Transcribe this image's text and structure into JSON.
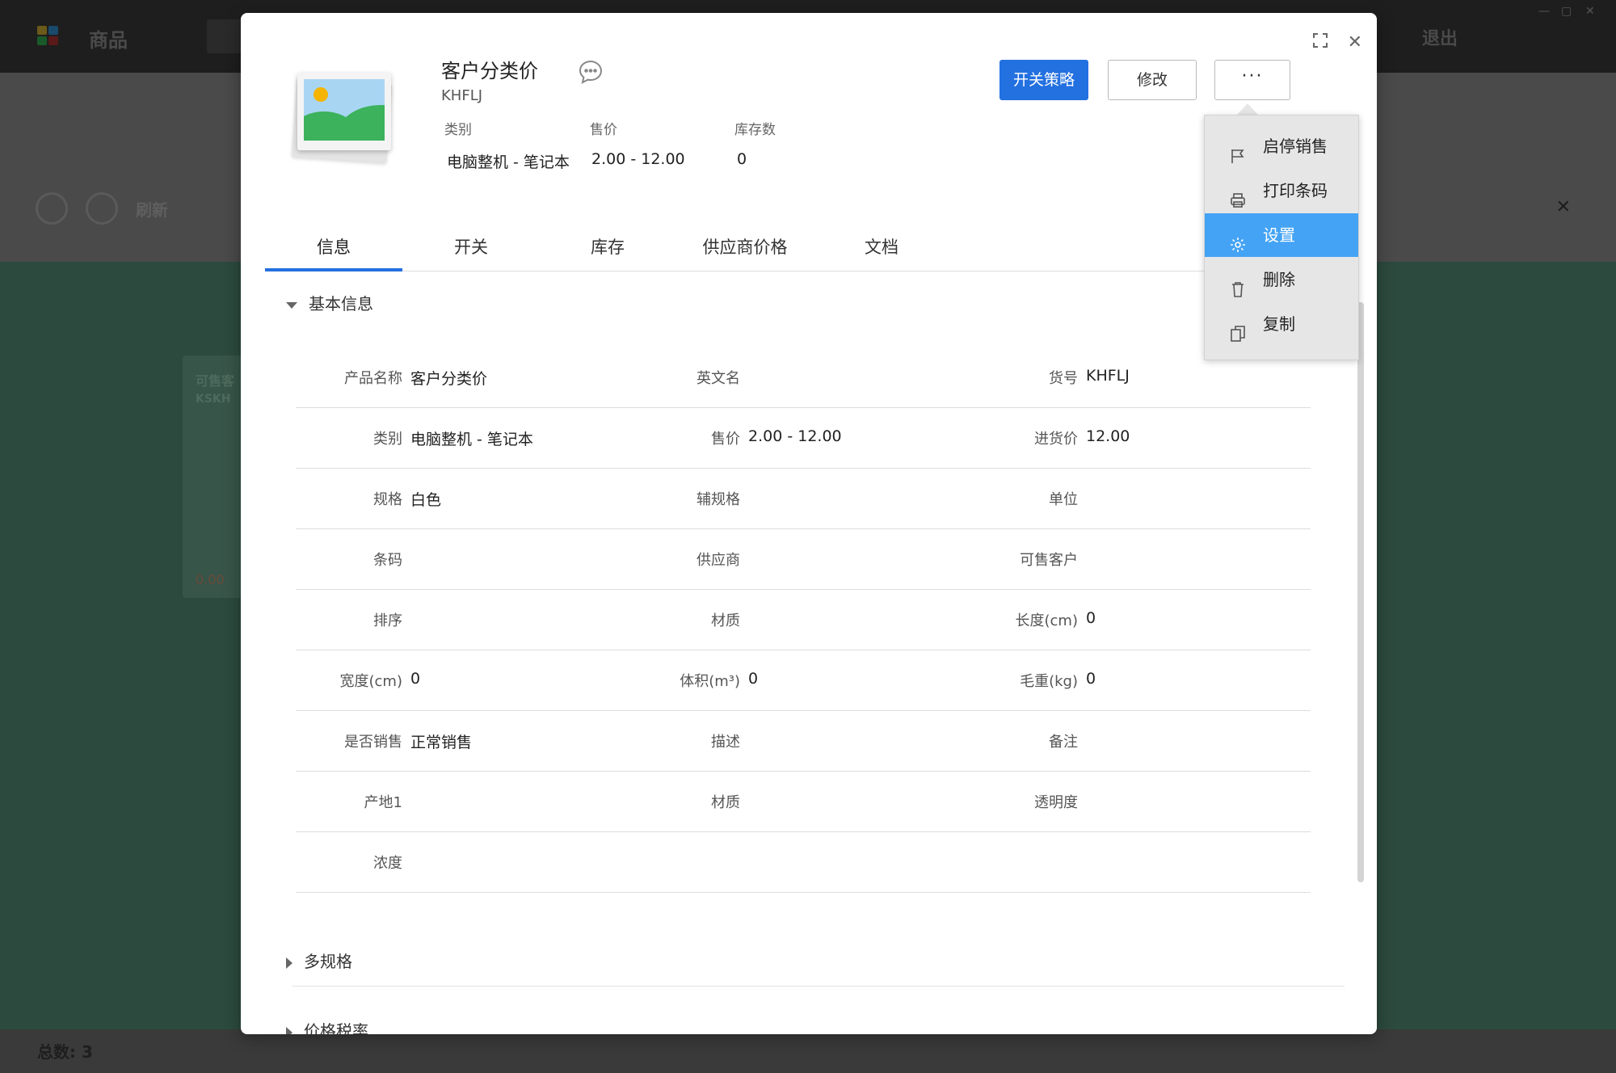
{
  "background": {
    "app_title": "商品",
    "exit_label": "退出",
    "refresh_label": "刷新",
    "card_title": "可售客",
    "card_code": "KSKH",
    "card_price": "0.00",
    "total_label": "总数: 3"
  },
  "dialog": {
    "product_name": "客户分类价",
    "product_code": "KHFLJ",
    "summary": {
      "category_label": "类别",
      "category_value": "电脑整机 - 笔记本",
      "price_label": "售价",
      "price_value": "2.00 - 12.00",
      "stock_label": "库存数",
      "stock_value": "0"
    },
    "buttons": {
      "switch_policy": "开关策略",
      "edit": "修改",
      "more": "···"
    },
    "tabs": [
      "信息",
      "开关",
      "库存",
      "供应商价格",
      "文档"
    ],
    "active_tab": "信息",
    "sections": {
      "basic_info": "基本信息",
      "multi_spec": "多规格",
      "price_tax": "价格税率"
    },
    "fields": [
      [
        {
          "label": "产品名称",
          "value": "客户分类价"
        },
        {
          "label": "英文名",
          "value": ""
        },
        {
          "label": "货号",
          "value": "KHFLJ"
        }
      ],
      [
        {
          "label": "类别",
          "value": "电脑整机 - 笔记本"
        },
        {
          "label": "售价",
          "value": "2.00 - 12.00"
        },
        {
          "label": "进货价",
          "value": "12.00"
        }
      ],
      [
        {
          "label": "规格",
          "value": "白色"
        },
        {
          "label": "辅规格",
          "value": ""
        },
        {
          "label": "单位",
          "value": ""
        }
      ],
      [
        {
          "label": "条码",
          "value": ""
        },
        {
          "label": "供应商",
          "value": ""
        },
        {
          "label": "可售客户",
          "value": ""
        }
      ],
      [
        {
          "label": "排序",
          "value": ""
        },
        {
          "label": "材质",
          "value": ""
        },
        {
          "label": "长度(cm)",
          "value": "0"
        }
      ],
      [
        {
          "label": "宽度(cm)",
          "value": "0"
        },
        {
          "label": "体积(m³)",
          "value": "0"
        },
        {
          "label": "毛重(kg)",
          "value": "0"
        }
      ],
      [
        {
          "label": "是否销售",
          "value": "正常销售"
        },
        {
          "label": "描述",
          "value": ""
        },
        {
          "label": "备注",
          "value": ""
        }
      ],
      [
        {
          "label": "产地1",
          "value": ""
        },
        {
          "label": "材质",
          "value": ""
        },
        {
          "label": "透明度",
          "value": ""
        }
      ],
      [
        {
          "label": "浓度",
          "value": ""
        },
        {
          "label": "",
          "value": ""
        },
        {
          "label": "",
          "value": ""
        }
      ]
    ]
  },
  "dropdown": {
    "items": [
      {
        "label": "启停销售",
        "icon": "flag-icon"
      },
      {
        "label": "打印条码",
        "icon": "printer-icon"
      },
      {
        "label": "设置",
        "icon": "gear-icon"
      },
      {
        "label": "删除",
        "icon": "trash-icon"
      },
      {
        "label": "复制",
        "icon": "copy-icon"
      }
    ],
    "active_index": 2
  },
  "colors": {
    "primary": "#2370e0",
    "dropdown_highlight": "#44a3f4",
    "tab_underline": "#2370e0"
  }
}
